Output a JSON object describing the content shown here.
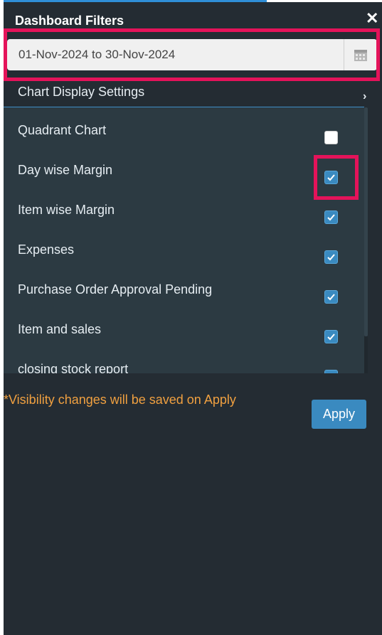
{
  "header": {
    "title": "Dashboard Filters",
    "close_glyph": "✕"
  },
  "date_filter": {
    "value": "01-Nov-2024 to 30-Nov-2024",
    "icon": "calendar-icon"
  },
  "chart_settings": {
    "label": "Chart Display Settings",
    "expand_glyph": "›"
  },
  "items": [
    {
      "label": "Quadrant Chart",
      "checked": false
    },
    {
      "label": "Day wise Margin",
      "checked": true
    },
    {
      "label": "Item wise Margin",
      "checked": true
    },
    {
      "label": "Expenses",
      "checked": true
    },
    {
      "label": "Purchase Order Approval Pending",
      "checked": true
    },
    {
      "label": "Item and sales",
      "checked": true
    },
    {
      "label": "closing stock report",
      "checked": true
    }
  ],
  "footer": {
    "note": "*Visibility changes will be saved on Apply",
    "apply_label": "Apply"
  },
  "colors": {
    "panel_bg": "#242c33",
    "list_bg": "#2c3a42",
    "accent": "#3a8ac0",
    "note": "#f0a040",
    "highlight": "#e4135a"
  }
}
